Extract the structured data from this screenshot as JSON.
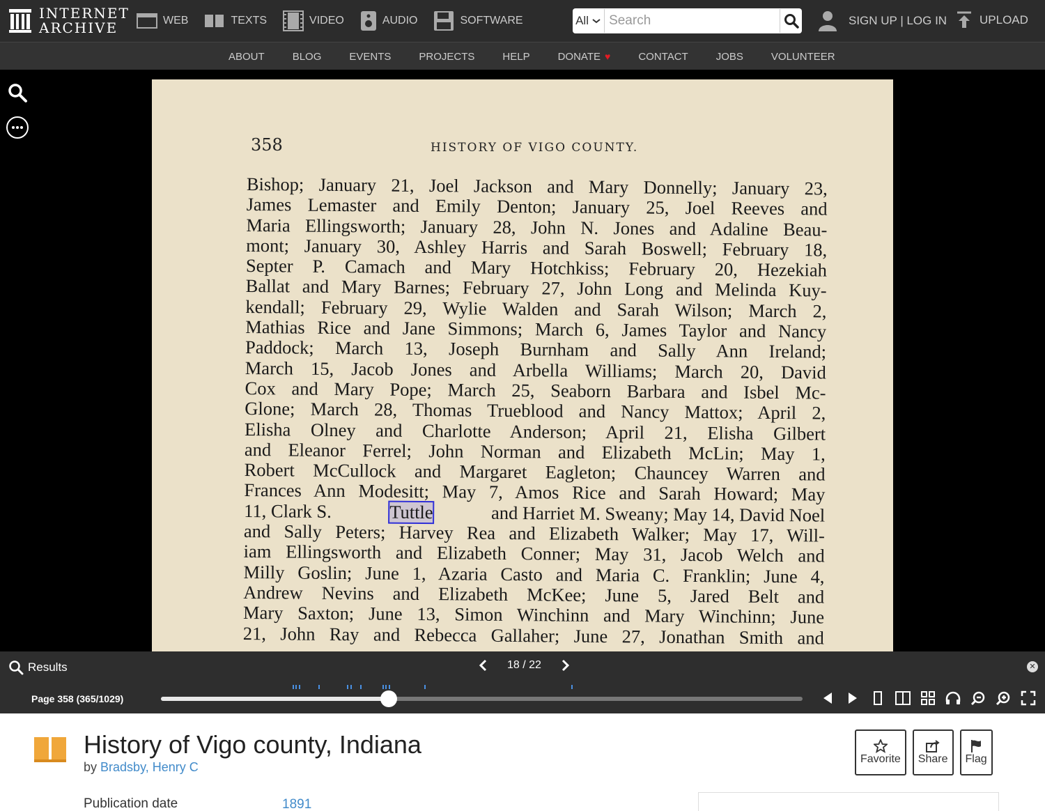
{
  "header": {
    "logo_line1": "INTERNET",
    "logo_line2": "ARCHIVE",
    "media": [
      {
        "label": "WEB",
        "icon": "web-icon"
      },
      {
        "label": "TEXTS",
        "icon": "texts-icon"
      },
      {
        "label": "VIDEO",
        "icon": "video-icon"
      },
      {
        "label": "AUDIO",
        "icon": "audio-icon"
      },
      {
        "label": "SOFTWARE",
        "icon": "software-icon"
      }
    ],
    "search": {
      "scope": "All",
      "placeholder": "Search"
    },
    "auth": "SIGN UP | LOG IN",
    "upload": "UPLOAD"
  },
  "subnav": [
    "ABOUT",
    "BLOG",
    "EVENTS",
    "PROJECTS",
    "HELP",
    "DONATE",
    "CONTACT",
    "JOBS",
    "VOLUNTEER"
  ],
  "book_page": {
    "number": "358",
    "heading": "HISTORY OF VIGO COUNTY.",
    "lines": [
      "Bishop; January 21, Joel Jackson and Mary Donnelly; January 23,",
      "James Lemaster and Emily Denton; January 25, Joel Reeves and",
      "Maria Ellingsworth; January 28, John N. Jones and Adaline Beau-",
      "mont; January 30, Ashley Harris and Sarah Boswell; February 18,",
      "Septer P. Camach and Mary Hotchkiss; February 20, Hezekiah",
      "Ballat and Mary Barnes; February 27, John Long and Melinda Kuy-",
      "kendall; February 29, Wylie Walden and Sarah Wilson; March 2,",
      "Mathias Rice and Jane Simmons; March 6, James Taylor and Nancy",
      "Paddock; March 13, Joseph Burnham and Sally Ann Ireland;",
      "March 15, Jacob Jones and Arbella Williams; March 20, David",
      "Cox and Mary Pope; March 25, Seaborn Barbara and Isbel Mc-",
      "Glone; March 28, Thomas Trueblood and Nancy Mattox; April 2,",
      "Elisha Olney and Charlotte Anderson; April 21, Elisha Gilbert",
      "and Eleanor Ferrel; John Norman and Elizabeth McLin; May 1,",
      "Robert McCullock and Margaret Eagleton; Chauncey Warren and",
      "Frances Ann Modesitt; May 7, Amos Rice and Sarah Howard; May",
      "11, Clark S.",
      "and Sally Peters; Harvey Rea and Elizabeth Walker; May 17, Will-",
      "iam Ellingsworth and Elizabeth Conner; May 31, Jacob Welch and",
      "Milly Goslin; June 1, Azaria Casto and Maria C. Franklin; June 4,",
      "Andrew Nevins and Elizabeth McKee; June 5, Jared Belt and",
      "Mary Saxton; June 13, Simon Winchinn and Mary Winchinn; June",
      "21, John Ray and Rebecca Gallaher; June 27, Jonathan Smith and"
    ],
    "highlight_word": "Tuttle",
    "line17_rest": "and Harriet M. Sweany; May 14, David Noel"
  },
  "results": {
    "label": "Results",
    "current": "18 / 22"
  },
  "navigator": {
    "page_label": "Page 358 (365/1029)",
    "progress": 0.355,
    "markers": [
      0.205,
      0.21,
      0.215,
      0.245,
      0.29,
      0.295,
      0.31,
      0.345,
      0.35,
      0.355,
      0.41,
      0.64
    ]
  },
  "details": {
    "title": "History of Vigo county, Indiana",
    "by": "by",
    "author": "Bradsby, Henry C",
    "actions": [
      "Favorite",
      "Share",
      "Flag"
    ],
    "pub_label": "Publication date",
    "pub_value": "1891"
  },
  "colors": {
    "accent": "#428bca",
    "highlight": "#2f2fd8",
    "donate_heart": "#e31b23",
    "book_icon": "#f0a73a"
  }
}
